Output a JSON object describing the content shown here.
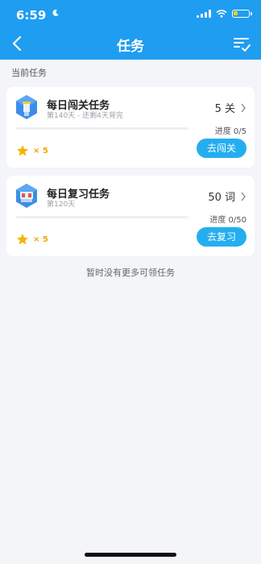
{
  "status": {
    "time": "6:59",
    "battery_level": 0.3,
    "icons": [
      "moon-icon",
      "signal-icon",
      "wifi-icon",
      "battery-icon"
    ]
  },
  "nav": {
    "title": "任务",
    "left_icon": "back-icon",
    "right_icon": "task-list-icon"
  },
  "section": {
    "label": "当前任务"
  },
  "tasks": [
    {
      "title": "每日闯关任务",
      "subtitle": "第140天 - 还剩4天背完",
      "count": "5 关",
      "progress_text": "进度 0/5",
      "progress": 0,
      "reward": "× 5",
      "button": "去闯关",
      "icon": "level-task-icon"
    },
    {
      "title": "每日复习任务",
      "subtitle": "第120天",
      "count": "50 词",
      "progress_text": "进度 0/50",
      "progress": 0,
      "reward": "× 5",
      "button": "去复习",
      "icon": "review-task-icon"
    }
  ],
  "empty_note": "暂时没有更多可领任务",
  "colors": {
    "primary": "#1f9df1",
    "button": "#24aef0",
    "reward": "#f0a500",
    "background": "#f3f5f9"
  }
}
